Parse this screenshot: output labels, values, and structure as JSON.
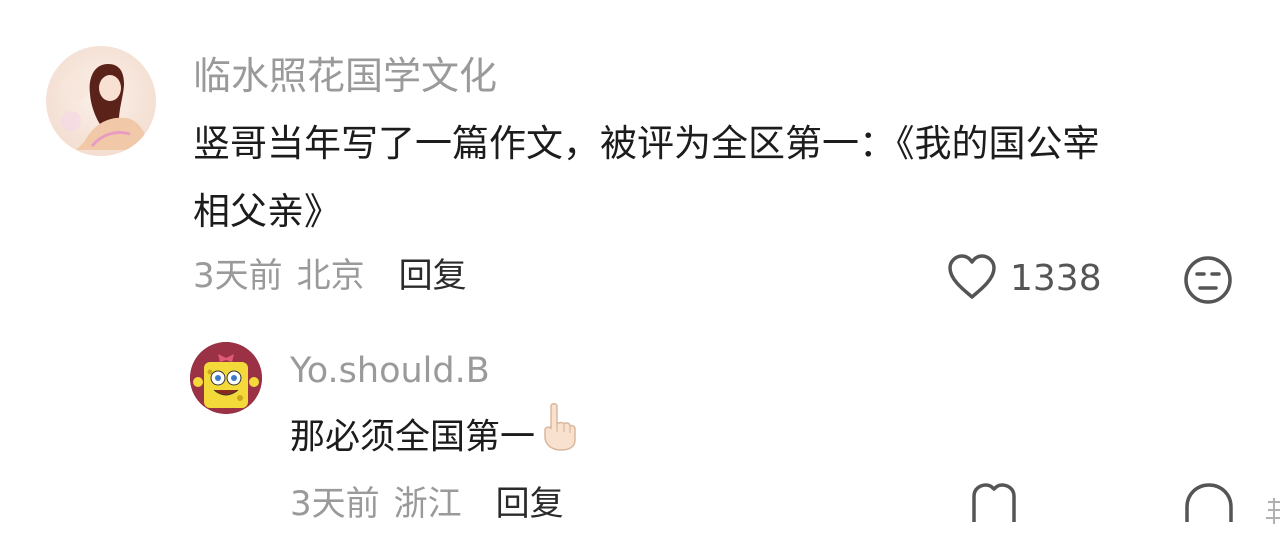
{
  "comment": {
    "username": "临水照花国学文化",
    "text_line1": "竖哥当年写了一篇作文，被评为全区第一：《我的国公宰",
    "text_line2": "相父亲》",
    "time": "3天前",
    "location": "北京",
    "reply_label": "回复",
    "like_count": "1338",
    "like_icon": "heart-outline-icon",
    "dislike_icon": "meh-face-icon"
  },
  "reply": {
    "username": "Yo.should.B",
    "text": "那必须全国第一",
    "emoji_icon": "pointing-up-finger-icon",
    "time": "3天前",
    "location": "浙江",
    "reply_label": "回复"
  },
  "colors": {
    "secondary_text": "#9a9a9a",
    "primary_text": "#1c1c1c",
    "icon_stroke": "#555555"
  }
}
